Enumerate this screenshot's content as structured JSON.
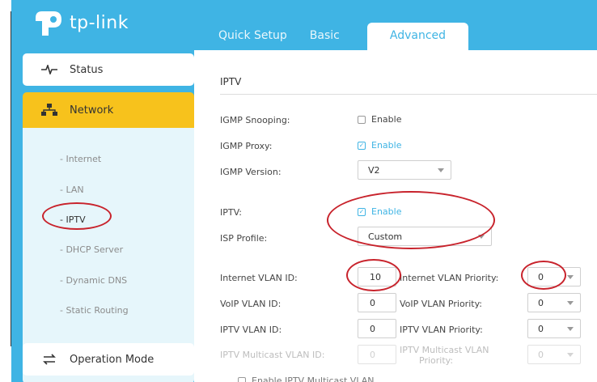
{
  "brand": {
    "name": "tp-link"
  },
  "tabs": [
    {
      "label": "Quick Setup",
      "active": false
    },
    {
      "label": "Basic",
      "active": false
    },
    {
      "label": "Advanced",
      "active": true
    }
  ],
  "sidebar": {
    "status_label": "Status",
    "network_label": "Network",
    "submenu": [
      "- Internet",
      "- LAN",
      "- IPTV",
      "- DHCP Server",
      "- Dynamic DNS",
      "- Static Routing"
    ],
    "active_sub": "- IPTV",
    "operation_label": "Operation Mode"
  },
  "main": {
    "title": "IPTV",
    "igmp_snooping": {
      "label": "IGMP Snooping:",
      "option": "Enable",
      "checked": false
    },
    "igmp_proxy": {
      "label": "IGMP Proxy:",
      "option": "Enable",
      "checked": true
    },
    "igmp_version": {
      "label": "IGMP Version:",
      "value": "V2"
    },
    "iptv": {
      "label": "IPTV:",
      "option": "Enable",
      "checked": true
    },
    "isp_profile": {
      "label": "ISP Profile:",
      "value": "Custom"
    },
    "internet_vlan_id": {
      "label": "Internet VLAN ID:",
      "value": "10"
    },
    "internet_vlan_priority": {
      "label": "Internet VLAN Priority:",
      "value": "0"
    },
    "voip_vlan_id": {
      "label": "VoIP VLAN ID:",
      "value": "0"
    },
    "voip_vlan_priority": {
      "label": "VoIP VLAN Priority:",
      "value": "0"
    },
    "iptv_vlan_id": {
      "label": "IPTV VLAN ID:",
      "value": "0"
    },
    "iptv_vlan_priority": {
      "label": "IPTV VLAN Priority:",
      "value": "0"
    },
    "iptv_multicast_vlan_id": {
      "label": "IPTV Multicast VLAN ID:",
      "value": "0"
    },
    "iptv_multicast_vlan_priority": {
      "label_line1": "IPTV Multicast VLAN",
      "label_line2": "Priority:",
      "value": "0"
    },
    "enable_multicast_vlan": {
      "label": "Enable IPTV Multicast VLAN",
      "checked": false
    }
  },
  "colors": {
    "brand_blue": "#3fb4e4",
    "active_yellow": "#f7c21c",
    "annotation_red": "#c8232c"
  },
  "icons": {
    "status": "pulse-icon",
    "network": "network-tree-icon",
    "operation": "operation-mode-icon",
    "dropdown": "chevron-down-icon",
    "checkbox": "checkbox-icon"
  }
}
